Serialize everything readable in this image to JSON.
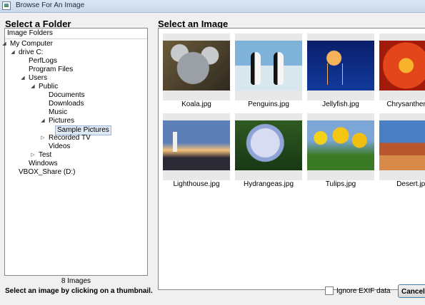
{
  "window": {
    "title": "Browse For An Image"
  },
  "left": {
    "heading": "Select a Folder",
    "tree_header": "Image Folders",
    "tree": [
      {
        "label": "My Computer",
        "arrow": "◢",
        "selected": false
      },
      {
        "label": "drive C:",
        "arrow": "◢",
        "selected": false
      },
      {
        "label": "PerfLogs",
        "arrow": "",
        "selected": false
      },
      {
        "label": "Program Files",
        "arrow": "",
        "selected": false
      },
      {
        "label": "Users",
        "arrow": "◢",
        "selected": false
      },
      {
        "label": "Public",
        "arrow": "◢",
        "selected": false
      },
      {
        "label": "Documents",
        "arrow": "",
        "selected": false
      },
      {
        "label": "Downloads",
        "arrow": "",
        "selected": false
      },
      {
        "label": "Music",
        "arrow": "",
        "selected": false
      },
      {
        "label": "Pictures",
        "arrow": "◢",
        "selected": false
      },
      {
        "label": "Sample Pictures",
        "arrow": "",
        "selected": true
      },
      {
        "label": "Recorded TV",
        "arrow": "▷",
        "selected": false
      },
      {
        "label": "Videos",
        "arrow": "",
        "selected": false
      },
      {
        "label": "Test",
        "arrow": "▷",
        "selected": false
      },
      {
        "label": "Windows",
        "arrow": "",
        "selected": false
      },
      {
        "label": "VBOX_Share (D:)",
        "arrow": "",
        "selected": false
      }
    ],
    "count": "8 Images"
  },
  "right": {
    "heading": "Select an Image",
    "images": [
      {
        "name": "Koala.jpg",
        "art": "koala"
      },
      {
        "name": "Penguins.jpg",
        "art": "penguins"
      },
      {
        "name": "Jellyfish.jpg",
        "art": "jellyfish"
      },
      {
        "name": "Chrysanthemum",
        "art": "chrys"
      },
      {
        "name": "Lighthouse.jpg",
        "art": "lighthouse"
      },
      {
        "name": "Hydrangeas.jpg",
        "art": "hydrangea"
      },
      {
        "name": "Tulips.jpg",
        "art": "tulips"
      },
      {
        "name": "Desert.jpg",
        "art": "desert"
      }
    ]
  },
  "footer": {
    "status": "Select an image by clicking on a thumbnail.",
    "exif_label": "Ignore EXIF data",
    "exif_checked": false,
    "cancel_label": "Cancel"
  }
}
